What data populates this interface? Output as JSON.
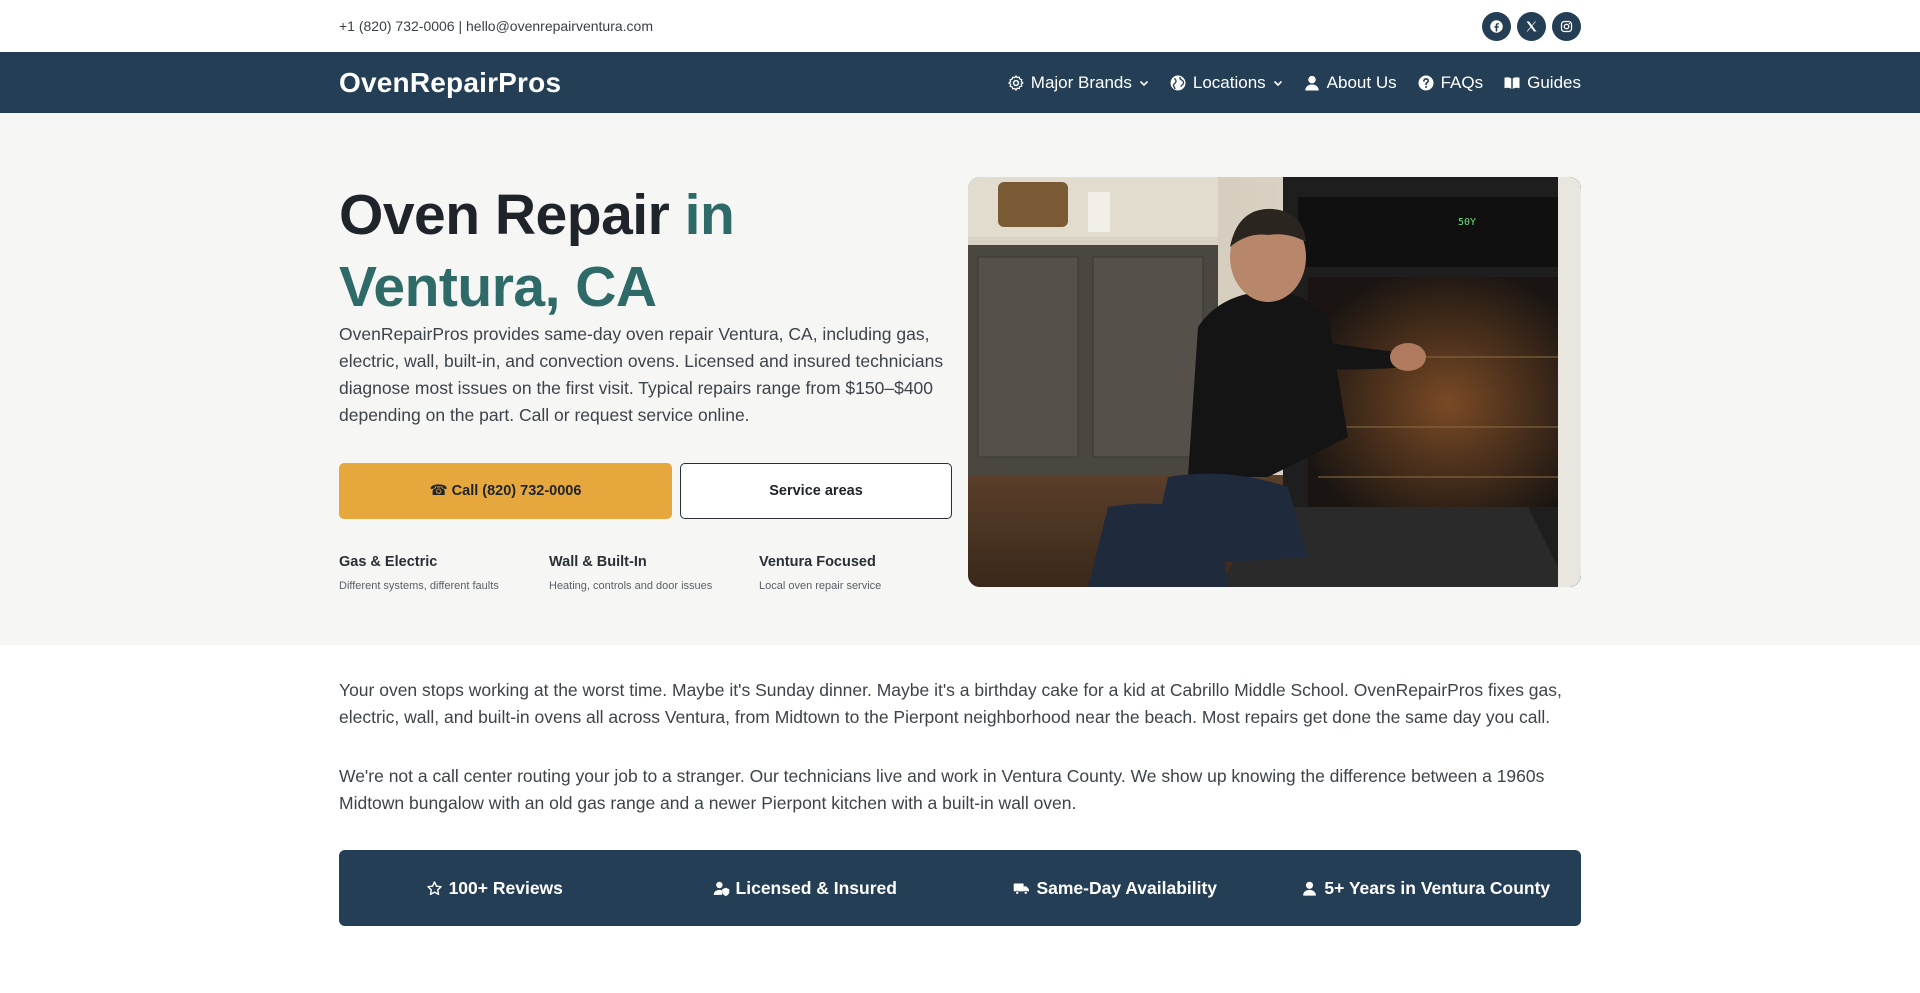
{
  "topbar": {
    "contact": "+1 (820) 732-0006 | hello@ovenrepairventura.com",
    "socials": [
      {
        "icon": "facebook-icon"
      },
      {
        "icon": "x-twitter-icon"
      },
      {
        "icon": "instagram-icon"
      }
    ]
  },
  "nav": {
    "brand": "OvenRepairPros",
    "items": [
      {
        "label": "Major Brands",
        "icon": "gear-icon",
        "dropdown": true
      },
      {
        "label": "Locations",
        "icon": "globe-icon",
        "dropdown": true
      },
      {
        "label": "About Us",
        "icon": "user-icon",
        "dropdown": false
      },
      {
        "label": "FAQs",
        "icon": "question-circle-icon",
        "dropdown": false
      },
      {
        "label": "Guides",
        "icon": "book-icon",
        "dropdown": false
      }
    ]
  },
  "hero": {
    "title_main": "Oven Repair",
    "title_accent": "in Ventura, CA",
    "description": "OvenRepairPros provides same-day oven repair Ventura, CA, including gas, electric, wall, built-in, and convection ovens. Licensed and insured technicians diagnose most issues on the first visit. Typical repairs range from $150–$400 depending on the part. Call or request service online.",
    "call_button": "☎ Call (820) 732-0006",
    "areas_button": "Service areas",
    "features": [
      {
        "title": "Gas & Electric",
        "subtitle": "Different systems, different faults"
      },
      {
        "title": "Wall & Built-In",
        "subtitle": "Heating, controls and door issues"
      },
      {
        "title": "Ventura Focused",
        "subtitle": "Local oven repair service"
      }
    ]
  },
  "intro": {
    "paragraph_1": "Your oven stops working at the worst time. Maybe it's Sunday dinner. Maybe it's a birthday cake for a kid at Cabrillo Middle School. OvenRepairPros fixes gas, electric, wall, and built-in ovens all across Ventura, from Midtown to the Pierpont neighborhood near the beach. Most repairs get done the same day you call.",
    "paragraph_2": "We're not a call center routing your job to a stranger. Our technicians live and work in Ventura County. We show up knowing the difference between a 1960s Midtown bungalow with an old gas range and a newer Pierpont kitchen with a built-in wall oven."
  },
  "trust": [
    {
      "label": "100+ Reviews",
      "icon": "star-icon"
    },
    {
      "label": "Licensed & Insured",
      "icon": "user-shield-icon"
    },
    {
      "label": "Same-Day Availability",
      "icon": "truck-icon"
    },
    {
      "label": "5+ Years in Ventura County",
      "icon": "user-icon"
    }
  ],
  "colors": {
    "navy": "#243f55",
    "accent_teal": "#2d6a68",
    "call_yellow": "#e6a73c",
    "hero_bg": "#f6f6f5"
  }
}
